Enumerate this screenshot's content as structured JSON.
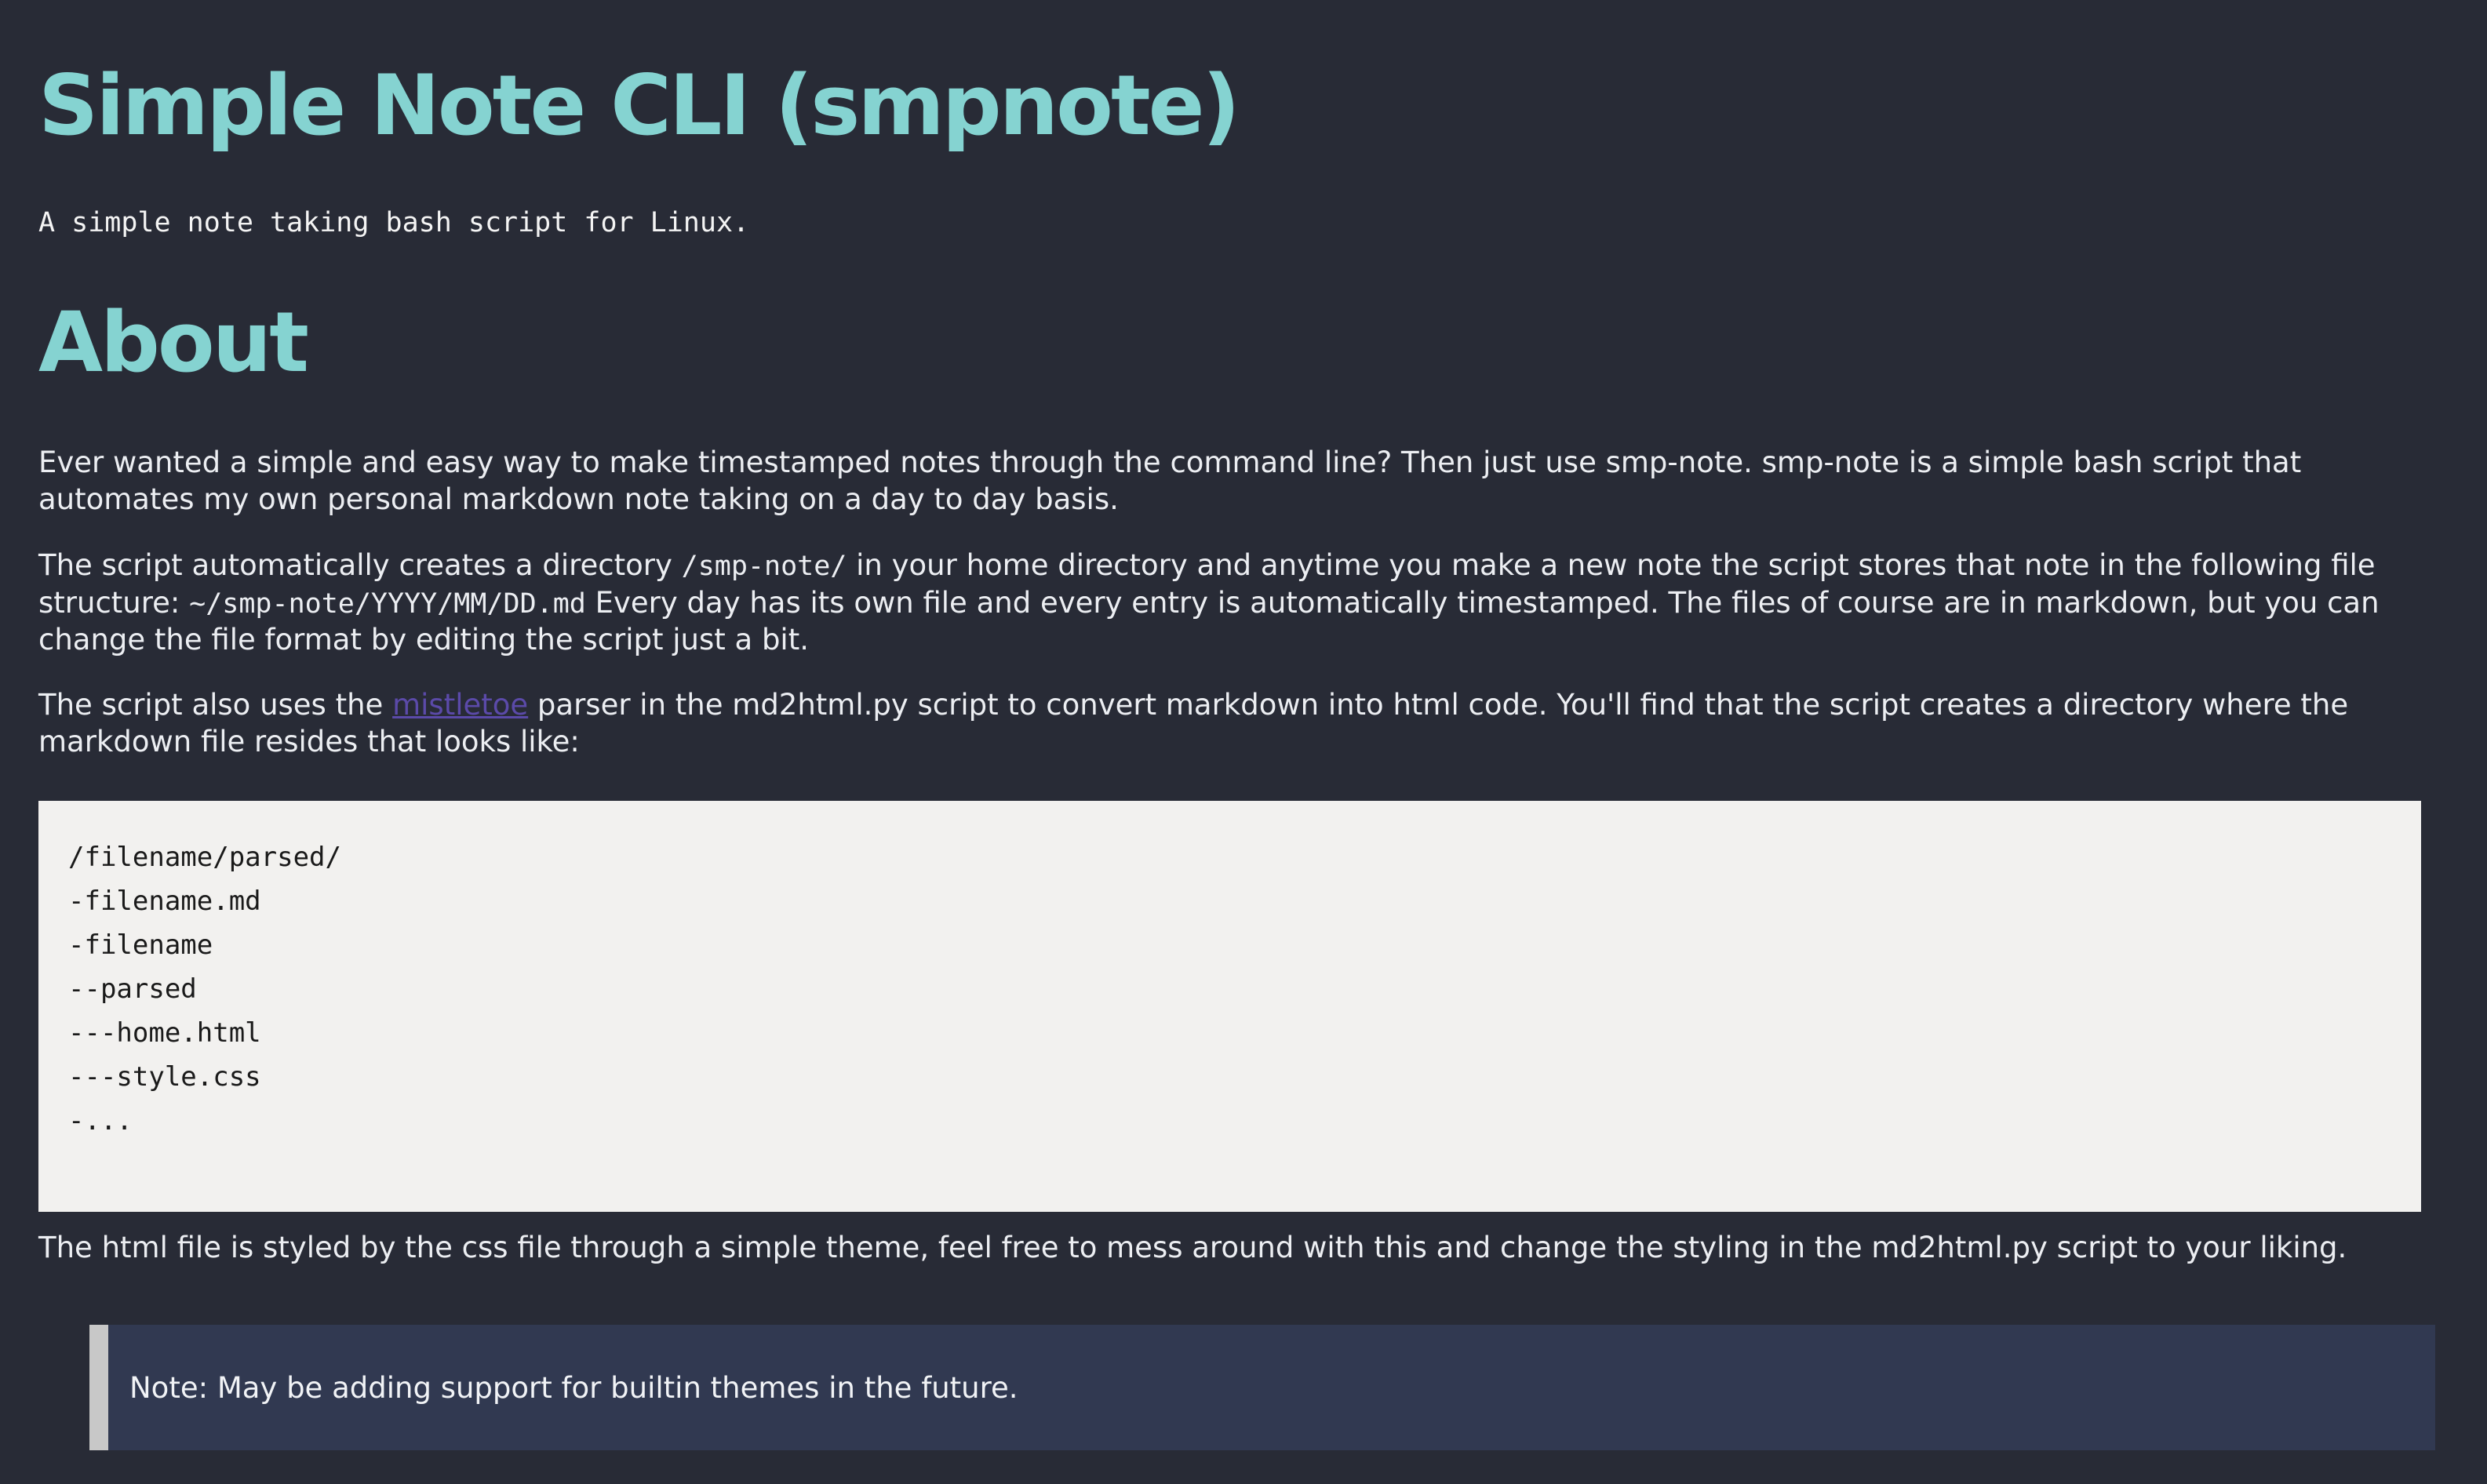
{
  "document": {
    "title": "Simple Note CLI (smpnote)",
    "subtitle": "A simple note taking bash script for Linux.",
    "section_title": "About",
    "paragraphs": [
      {
        "text": "Ever wanted a simple and easy way to make timestamped notes through the command line? Then just use smp-note. smp-note is a simple bash script that automates my own personal markdown note taking on a day to day basis."
      },
      {
        "before_code": "The script automatically creates a directory ",
        "code": "/smp-note/",
        "middle": " in your home directory and anytime you make a new note the script stores that note in the following file structure: ",
        "code_2": "~/smp-note/YYYY/MM/DD.md",
        "after_code": " Every day has its own file and every entry is automatically timestamped. The files of course are in markdown, but you can change the file format by editing the script just a bit."
      },
      {
        "before_link": "The script also uses the ",
        "link": "mistletoe",
        "after_link": " parser in the md2html.py script to convert markdown into html code. You'll find that the script creates a directory where the markdown file resides that looks like:"
      },
      {
        "text": "The html file is styled by the css file through a simple theme, feel free to mess around with this and change the styling in the md2html.py script to your liking."
      }
    ],
    "code_block": {
      "lines": [
        "/filename/parsed/",
        "",
        "-filename.md",
        "-filename",
        "--parsed",
        "---home.html",
        "---style.css",
        "-..."
      ]
    },
    "callout": "Note: May be adding support for builtin themes in the future."
  },
  "colors": {
    "background": "#282b36",
    "heading": "#85d3d1",
    "link": "#5b4aa9",
    "code_background": "#f2f1ef",
    "callout_background": "#313951",
    "callout_border": "#c8c8c8"
  }
}
